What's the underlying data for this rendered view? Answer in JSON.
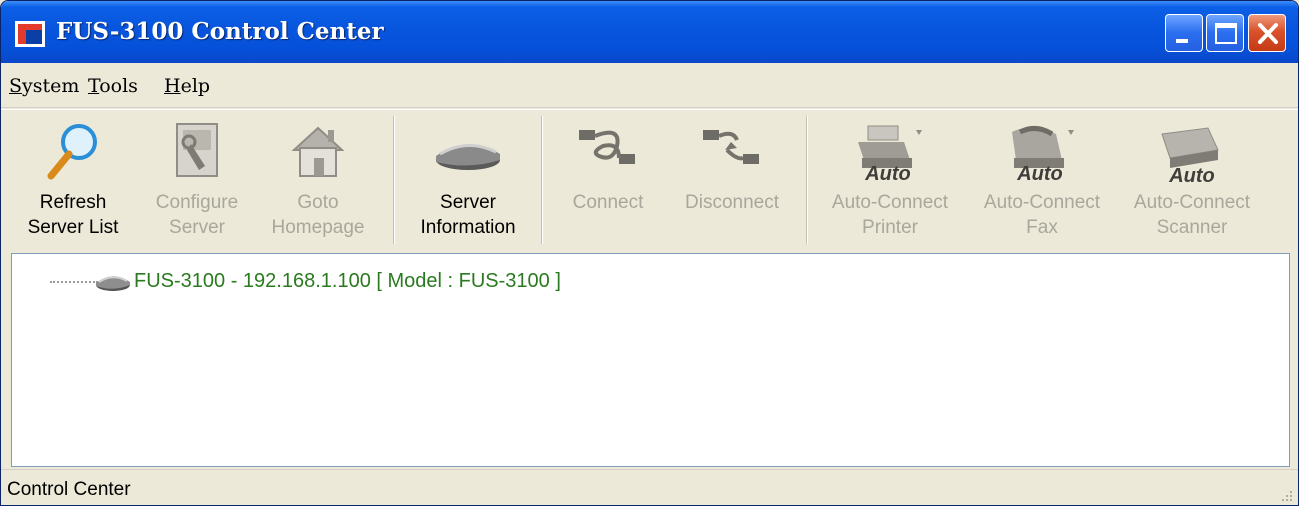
{
  "window": {
    "title": "FUS-3100 Control Center"
  },
  "menu": [
    {
      "label": "System",
      "accel": "S",
      "rest": "ystem"
    },
    {
      "label": "Tools",
      "accel": "T",
      "rest": "ools"
    },
    {
      "label": "Help",
      "accel": "H",
      "rest": "elp"
    }
  ],
  "toolbar": [
    {
      "label": "Refresh\nServer List",
      "icon": "magnifier-icon",
      "enabled": true
    },
    {
      "label": "Configure\nServer",
      "icon": "configure-icon",
      "enabled": false
    },
    {
      "label": "Goto\nHomepage",
      "icon": "home-icon",
      "enabled": false
    },
    {
      "label": "Server\nInformation",
      "icon": "server-icon",
      "enabled": true
    },
    {
      "label": "Connect",
      "icon": "connect-cable-icon",
      "enabled": false
    },
    {
      "label": "Disconnect",
      "icon": "disconnect-cable-icon",
      "enabled": false
    },
    {
      "label": "Auto-Connect\nPrinter",
      "icon": "auto-printer-icon",
      "enabled": false,
      "badge": "Auto"
    },
    {
      "label": "Auto-Connect\nFax",
      "icon": "auto-fax-icon",
      "enabled": false,
      "badge": "Auto"
    },
    {
      "label": "Auto-Connect\nScanner",
      "icon": "auto-scanner-icon",
      "enabled": false,
      "badge": "Auto"
    }
  ],
  "tree": {
    "nodes": [
      {
        "label": "FUS-3100 - 192.168.1.100 [ Model : FUS-3100 ]",
        "icon": "server-icon"
      }
    ]
  },
  "status": {
    "text": "Control Center"
  },
  "colors": {
    "title_bar": "#0855dd",
    "node_text": "#2a7b1f",
    "disabled_text": "#a9a79c",
    "close_button": "#d9522c"
  }
}
